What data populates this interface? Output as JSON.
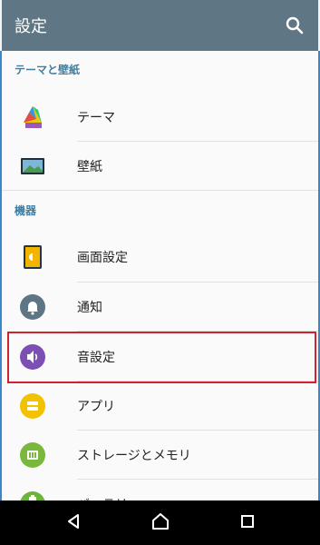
{
  "appbar": {
    "title": "設定",
    "search_icon": "search-icon"
  },
  "sections": [
    {
      "header": "テーマと壁紙",
      "items": [
        {
          "label": "テーマ",
          "icon": "theme-palette-icon"
        },
        {
          "label": "壁紙",
          "icon": "wallpaper-icon"
        }
      ]
    },
    {
      "header": "機器",
      "items": [
        {
          "label": "画面設定",
          "icon": "display-icon"
        },
        {
          "label": "通知",
          "icon": "notification-bell-icon"
        },
        {
          "label": "音設定",
          "icon": "sound-icon"
        },
        {
          "label": "アプリ",
          "icon": "apps-icon"
        },
        {
          "label": "ストレージとメモリ",
          "icon": "storage-icon"
        },
        {
          "label": "バッテリー",
          "icon": "battery-icon"
        }
      ]
    }
  ],
  "navbar": {
    "back": "back-icon",
    "home": "home-icon",
    "recents": "recents-icon"
  },
  "colors": {
    "appbar": "#5f7684",
    "section_header": "#3f7ea1",
    "highlight": "#d0232d"
  }
}
